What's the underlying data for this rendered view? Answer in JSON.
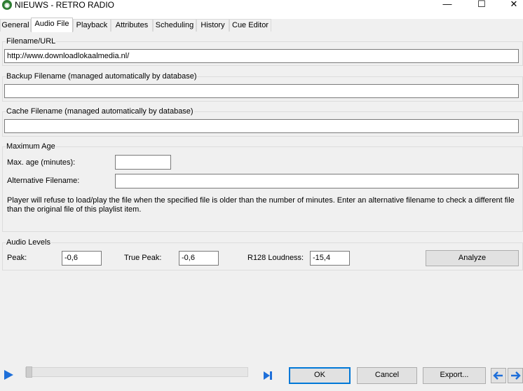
{
  "window": {
    "title": "NIEUWS - RETRO RADIO",
    "minimize": "—",
    "maximize": "☐",
    "close": "✕"
  },
  "tabs": [
    {
      "label": "General"
    },
    {
      "label": "Audio File"
    },
    {
      "label": "Playback"
    },
    {
      "label": "Attributes"
    },
    {
      "label": "Scheduling"
    },
    {
      "label": "History"
    },
    {
      "label": "Cue Editor"
    }
  ],
  "filename": {
    "label": "Filename/URL",
    "value": "http://www.downloadlokaalmedia.nl/"
  },
  "backup": {
    "label": "Backup Filename (managed automatically by database)",
    "value": ""
  },
  "cache": {
    "label": "Cache Filename (managed automatically by database)",
    "value": ""
  },
  "max_age": {
    "group_label": "Maximum Age",
    "age_label": "Max. age (minutes):",
    "age_value": "",
    "alt_label": "Alternative Filename:",
    "alt_value": "",
    "description": "Player will refuse to load/play the file when the specified file is older than the number of minutes. Enter an alternative filename to check a different file than the original file of this playlist item."
  },
  "audio_levels": {
    "group_label": "Audio Levels",
    "peak_label": "Peak:",
    "peak_value": "-0,6",
    "true_peak_label": "True Peak:",
    "true_peak_value": "-0,6",
    "loudness_label": "R128 Loudness:",
    "loudness_value": "-15,4",
    "analyze_label": "Analyze"
  },
  "footer": {
    "ok_label": "OK",
    "cancel_label": "Cancel",
    "export_label": "Export...",
    "play_icon": "play-icon",
    "skip_end_icon": "skip-to-end-icon",
    "prev_icon": "arrow-left-icon",
    "next_icon": "arrow-right-icon",
    "accent_color": "#0078d7"
  }
}
